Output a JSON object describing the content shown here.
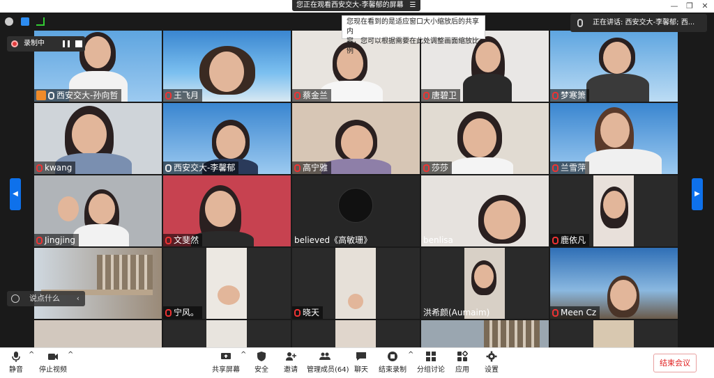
{
  "window": {
    "share_banner": "您正在观看西安交大-李馨郁的屏幕",
    "minimize": "—",
    "restore": "❐",
    "close": "✕"
  },
  "tooltip": {
    "line1": "您现在看到的是适应窗口大小缩放后的共享内",
    "line2": "容，您可以根据需要在此处调整画面缩放比例"
  },
  "speaking": "正在讲话: 西安交大-李馨郁; 西...",
  "recording": {
    "label": "录制中"
  },
  "chat_placeholder": "说点什么",
  "nav": {
    "left": "◀",
    "right": "▶"
  },
  "tiles": [
    {
      "name": "西安交大-孙向哲",
      "mic": "host"
    },
    {
      "name": "王飞月",
      "mic": "off"
    },
    {
      "name": "蔡金兰",
      "mic": "off"
    },
    {
      "name": "唐碧卫",
      "mic": "off"
    },
    {
      "name": "梦寒箫",
      "mic": "off"
    },
    {
      "name": "kwang",
      "mic": "off"
    },
    {
      "name": "西安交大-李馨郁",
      "mic": "on"
    },
    {
      "name": "高宁雅",
      "mic": "off"
    },
    {
      "name": "莎莎",
      "mic": "off"
    },
    {
      "name": "兰雪萍",
      "mic": "off"
    },
    {
      "name": "Jingjing",
      "mic": "off"
    },
    {
      "name": "文斐然",
      "mic": "off"
    },
    {
      "name": "believed《高敏珊》",
      "mic": "none"
    },
    {
      "name": "benlisa",
      "mic": "none"
    },
    {
      "name": "鹿依凡",
      "mic": "off"
    },
    {
      "name": "",
      "mic": "none"
    },
    {
      "name": "宁风。",
      "mic": "off"
    },
    {
      "name": "晓天",
      "mic": "off"
    },
    {
      "name": "洪希颜(Aumaim)",
      "mic": "none"
    },
    {
      "name": "Meen Cz",
      "mic": "off"
    }
  ],
  "toolbar": {
    "mute": "静音",
    "stop_video": "停止视频",
    "share_screen": "共享屏幕",
    "security": "安全",
    "invite": "邀请",
    "participants": "管理成员(64)",
    "chat": "聊天",
    "end_recording": "结束录制",
    "breakout": "分组讨论",
    "apps": "应用",
    "settings": "设置",
    "end_meeting": "结束会议",
    "caret": "^"
  }
}
